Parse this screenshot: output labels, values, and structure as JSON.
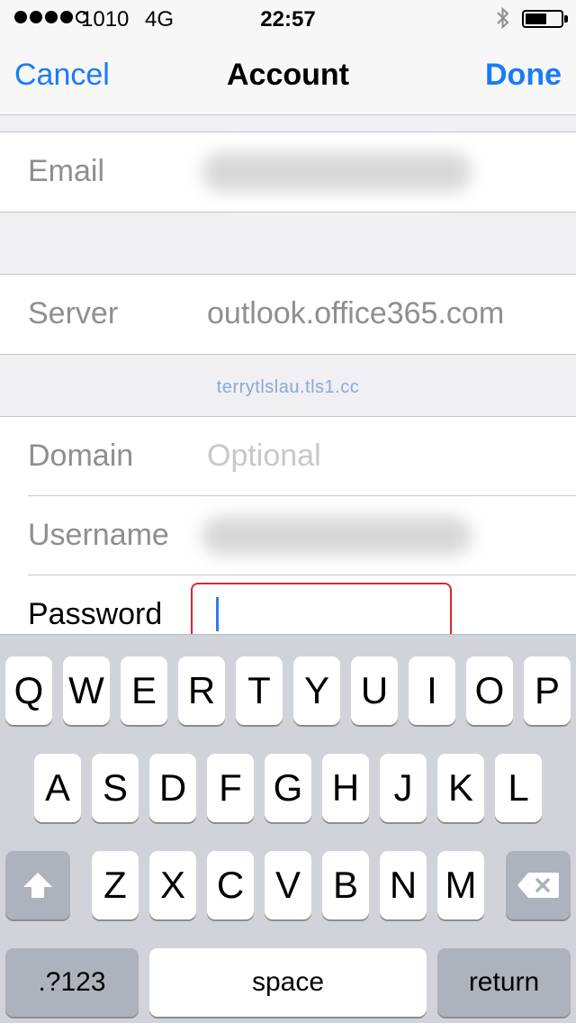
{
  "status_bar": {
    "carrier": "1010",
    "network": "4G",
    "time": "22:57",
    "battery_level_percent": 60
  },
  "nav": {
    "cancel_label": "Cancel",
    "title": "Account",
    "done_label": "Done",
    "accent_color": "#1a7cf5"
  },
  "form": {
    "email": {
      "label": "Email",
      "value_state": "redacted-blurred"
    },
    "server": {
      "label": "Server",
      "value": "outlook.office365.com"
    },
    "watermark": "terrytlslau.tls1.cc",
    "domain": {
      "label": "Domain",
      "placeholder": "Optional"
    },
    "username": {
      "label": "Username",
      "value_state": "redacted-blurred"
    },
    "password": {
      "label": "Password",
      "value": "",
      "highlight_color": "#e0252c"
    }
  },
  "keyboard": {
    "row1": [
      "Q",
      "W",
      "E",
      "R",
      "T",
      "Y",
      "U",
      "I",
      "O",
      "P"
    ],
    "row2": [
      "A",
      "S",
      "D",
      "F",
      "G",
      "H",
      "J",
      "K",
      "L"
    ],
    "row3": [
      "Z",
      "X",
      "C",
      "V",
      "B",
      "N",
      "M"
    ],
    "shift_icon": "shift-arrow-icon",
    "delete_icon": "backspace-icon",
    "numbers_label": ".?123",
    "space_label": "space",
    "return_label": "return"
  }
}
